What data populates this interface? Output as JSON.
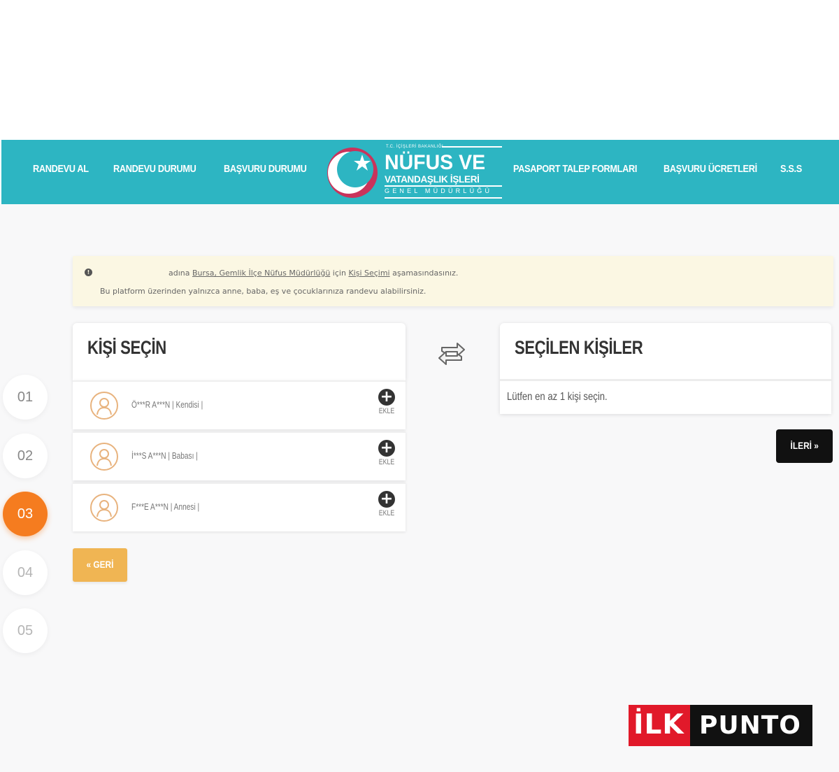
{
  "nav": {
    "left_items": [
      "RANDEVU AL",
      "RANDEVU DURUMU",
      "BAŞVURU DURUMU"
    ],
    "right_items": [
      "PASAPORT TALEP FORMLARI",
      "BAŞVURU ÜCRETLERİ",
      "S.S.S"
    ],
    "logo": {
      "top_text": "T.C. İÇİŞLERİ BAKANLIĞI",
      "title": "NÜFUS VE",
      "subtitle": "VATANDAŞLIK İŞLERİ",
      "small": "GENEL MÜDÜRLÜĞÜ"
    }
  },
  "alert": {
    "line1_prefix": "adına",
    "line1_office": "Bursa, Gemlik İlçe Nüfus Müdürlüğü",
    "line1_mid": "için",
    "line1_stage": "Kişi Seçimi",
    "line1_suffix": "aşamasındasınız.",
    "line2": "Bu platform üzerinden yalnızca anne, baba, eş ve çocuklarınıza randevu alabilirsiniz."
  },
  "steps": [
    "01",
    "02",
    "03",
    "04",
    "05"
  ],
  "active_step": "03",
  "select_panel": {
    "title": "KİŞİ SEÇİN",
    "add_label": "EKLE",
    "people": [
      {
        "name": "Ö***R A***N | Kendisi |"
      },
      {
        "name": "İ***S A***N | Babası |"
      },
      {
        "name": "F***E A***N | Annesi |"
      }
    ]
  },
  "selected_panel": {
    "title": "SEÇİLEN KİŞİLER",
    "empty_message": "Lütfen en az 1 kişi seçin."
  },
  "buttons": {
    "next": "İLERİ »",
    "back": "« GERİ"
  },
  "watermark": {
    "part1": "İLK",
    "part2": "PUNTO"
  },
  "colors": {
    "nav": "#2db5c2",
    "active_step": "#f57c1f",
    "back_button": "#f0b553",
    "next_button": "#111111",
    "alert_bg": "#fbf7e3"
  }
}
